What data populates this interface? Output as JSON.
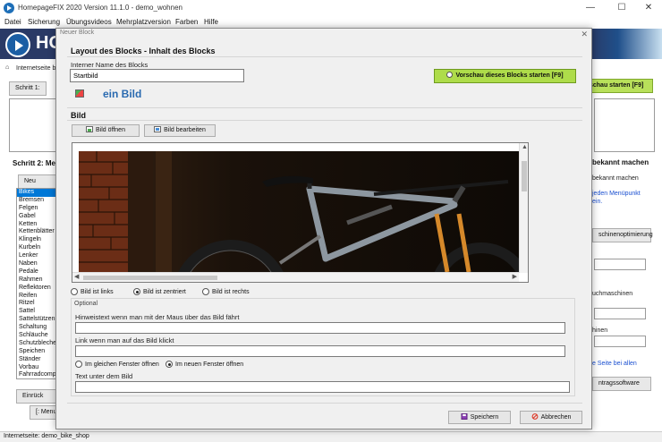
{
  "window": {
    "title": "HomepageFIX 2020 Version 11.1.0 - demo_wohnen",
    "minimize": "—",
    "maximize": "☐",
    "close": "✕"
  },
  "menu": [
    "Datei",
    "Sicherung",
    "Übungsvideos",
    "Mehrplatzversion",
    "Farben",
    "Hilfe"
  ],
  "banner": {
    "logo": "HO"
  },
  "background": {
    "internetseite_label": "Internetseite be",
    "schritt1_button": "Schritt 1:",
    "schritt2_label": "Schritt 2: Me",
    "neu_button": "Neu",
    "einrueck_button": "Einrück",
    "menu_button": "[: Menu",
    "right_preview_button": "schau starten [F9]",
    "right_bekannt_bold": "bekannt machen",
    "right_bekannt": "bekannt machen",
    "right_link1": "jeden Menüpunkt",
    "right_link2": "ein.",
    "right_optimierung_button": "schinenoptimierung",
    "right_suchmaschinen": "uchmaschinen",
    "right_hinen": "hinen",
    "right_link3": "e Seite bei allen",
    "right_software_button": "ntragssoftware",
    "list_items": [
      "Bikes",
      "Bremsen",
      "Felgen",
      "Gabel",
      "Ketten",
      "Kettenblätter",
      "Klingeln",
      "Kurbeln",
      "Lenker",
      "Naben",
      "Pedale",
      "Rahmen",
      "Reflektoren",
      "Reifen",
      "Ritzel",
      "Sattel",
      "Sattelstützen",
      "Schaltung",
      "Schläuche",
      "Schutzbleche",
      "Speichen",
      "Ständer",
      "Vorbau",
      "Fahrradcompu"
    ],
    "selected_index": 0
  },
  "status": {
    "text": "Internetseite: demo_bike_shop"
  },
  "dialog": {
    "title": "Neuer Block",
    "close": "✕",
    "header": "Layout des Blocks - Inhalt des Blocks",
    "name_label": "Interner Name des Blocks",
    "name_value": "Startbild",
    "block_type": "ein Bild",
    "preview_button": "Vorschau dieses Blocks starten [F9]",
    "section_title": "Bild",
    "open_button": "Bild öffnen",
    "edit_button": "Bild bearbeiten",
    "align_options": [
      "Bild ist links",
      "Bild ist zentriert",
      "Bild ist rechts"
    ],
    "align_selected": 1,
    "optional_label": "Optional",
    "hover_label": "Hinweistext wenn man mit der Maus über das Bild fährt",
    "hover_value": "",
    "link_label": "Link wenn man auf das Bild klickt",
    "link_value": "",
    "window_options": [
      "Im gleichen Fenster öffnen",
      "Im neuen Fenster öffnen"
    ],
    "window_selected": 1,
    "caption_label": "Text unter dem Bild",
    "caption_value": "",
    "save_button": "Speichern",
    "cancel_button": "Abbrechen"
  },
  "colors": {
    "accent_green": "#aedc4a",
    "banner_blue": "#2a3a66",
    "selection_blue": "#0078d7",
    "link_blue": "#1a4fd0"
  },
  "icons": [
    "app-icon",
    "nav-forward-icon",
    "image-icon",
    "open-image-icon",
    "edit-image-icon",
    "save-icon",
    "cancel-icon"
  ]
}
